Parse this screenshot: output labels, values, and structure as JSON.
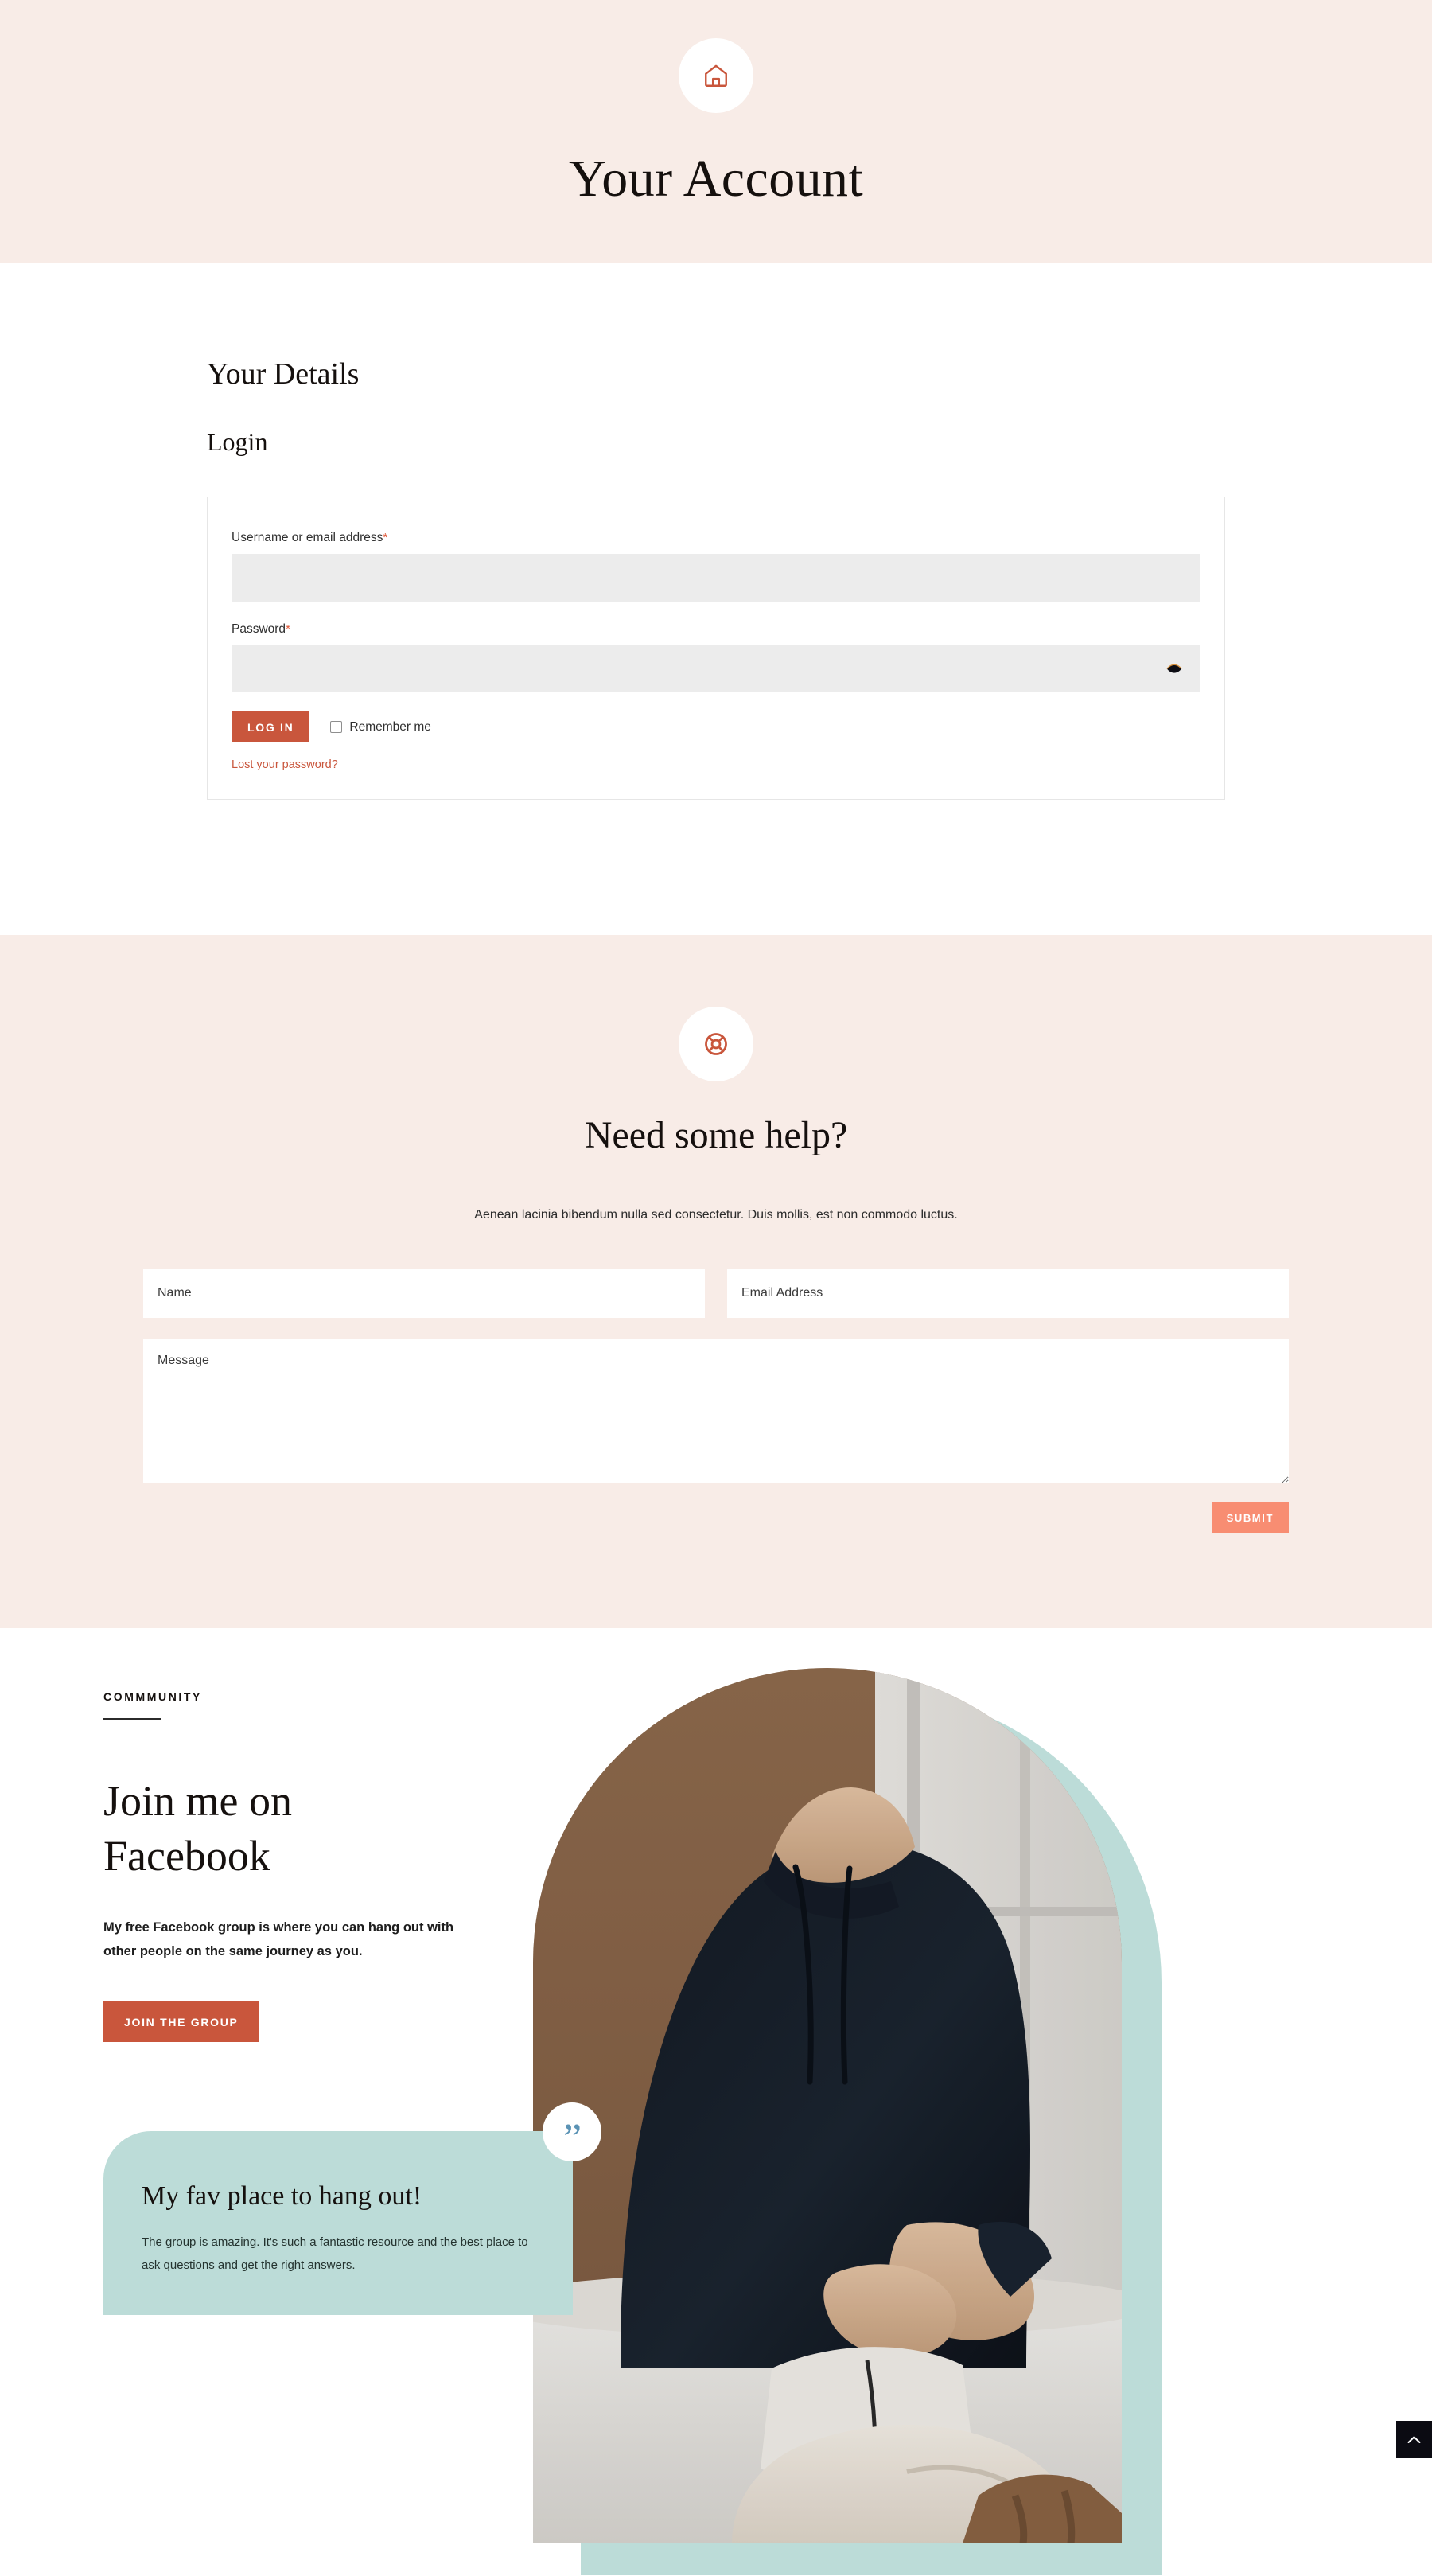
{
  "header": {
    "icon": "home-icon",
    "title": "Your Account",
    "bg_color": "#f8ece7",
    "icon_color": "#c9563c"
  },
  "account": {
    "details_heading": "Your Details",
    "login_heading": "Login",
    "form": {
      "username_label": "Username or email address",
      "username_required_mark": "*",
      "username_value": "",
      "username_placeholder": "",
      "password_label": "Password",
      "password_required_mark": "*",
      "password_value": "",
      "password_placeholder": "",
      "password_toggle_icon": "eye-icon",
      "login_button": "LOG IN",
      "remember_label": "Remember me",
      "remember_checked": false,
      "lost_password_link": "Lost your password?",
      "button_color": "#c9563c",
      "link_color": "#c9563c",
      "input_bg": "#ececec"
    }
  },
  "help": {
    "icon": "lifebuoy-icon",
    "title": "Need some help?",
    "subtitle": "Aenean lacinia bibendum nulla sed consectetur. Duis mollis, est non commodo luctus.",
    "bg_color": "#f8ece7",
    "name_placeholder": "Name",
    "name_value": "",
    "email_placeholder": "Email Address",
    "email_value": "",
    "message_placeholder": "Message",
    "message_value": "",
    "submit_button": "SUBMIT",
    "submit_color": "#f88d72"
  },
  "community": {
    "eyebrow": "COMMMUNITY",
    "title": "Join me on Facebook",
    "body": "My free Facebook group is where you can hang out with other people on the same journey as you.",
    "join_button": "JOIN THE GROUP",
    "join_button_color": "#c9563c",
    "testimonial": {
      "quote_icon": "quote-icon",
      "title": "My fav place to hang out!",
      "body": "The group is amazing. It's such a fantastic resource and the best place to ask questions and get the right answers.",
      "bg_color": "#bcdcd8",
      "quote_color": "#5b93b5"
    },
    "image": {
      "alt": "person in dark sweater at a table with an open book and a cup of coffee",
      "shape": "arch",
      "backdrop_color": "#bcdcd8"
    }
  },
  "scroll_top": {
    "icon": "chevron-up-icon",
    "bg_color": "#0b0b12"
  }
}
